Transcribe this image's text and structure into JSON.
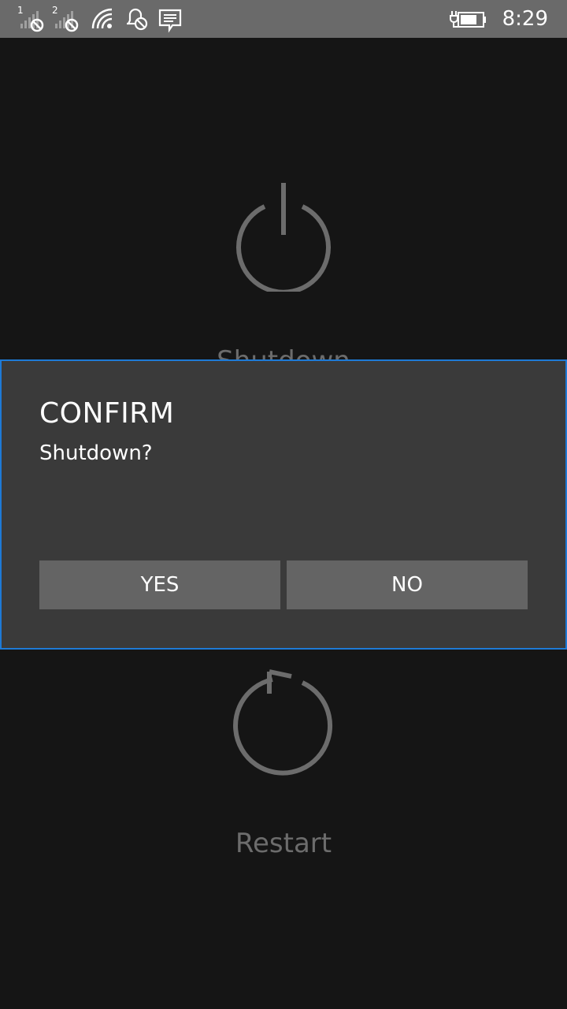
{
  "status_bar": {
    "sim1_label": "1",
    "sim2_label": "2",
    "time": "8:29",
    "icons": [
      "signal-sim1-no-service-icon",
      "signal-sim2-no-service-icon",
      "wifi-icon",
      "quiet-hours-icon",
      "notification-message-icon",
      "battery-charging-icon"
    ]
  },
  "options": {
    "shutdown": {
      "label": "Shutdown",
      "icon": "power-icon"
    },
    "restart": {
      "label": "Restart",
      "icon": "restart-icon"
    }
  },
  "dialog": {
    "title": "CONFIRM",
    "message": "Shutdown?",
    "yes_label": "YES",
    "no_label": "NO"
  },
  "colors": {
    "background": "#151515",
    "status_bar": "#6a6a6a",
    "dialog_bg": "#3a3a3a",
    "dialog_border": "#1e7ad6",
    "button_bg": "#646464",
    "option_gray": "#6c6c6c"
  }
}
